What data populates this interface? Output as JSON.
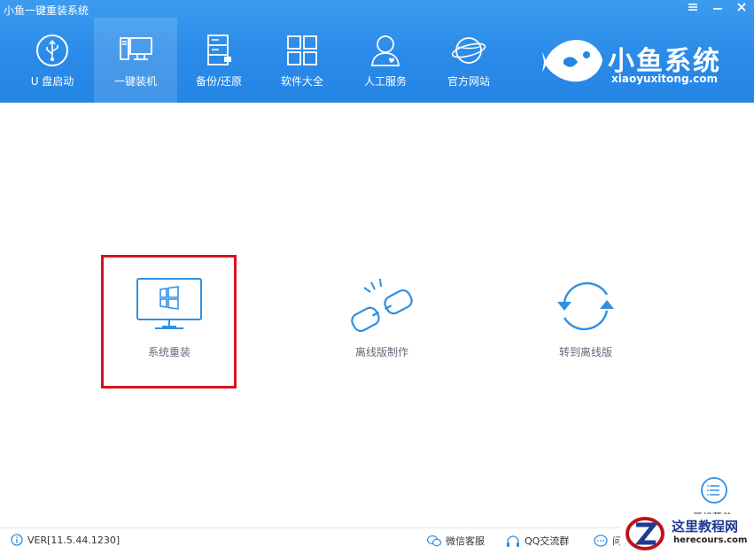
{
  "window": {
    "title": "小鱼一键重装系统",
    "controls": [
      "menu-icon",
      "minimize-icon",
      "close-icon"
    ]
  },
  "nav": {
    "items": [
      {
        "label": "U 盘启动",
        "icon": "usb-icon"
      },
      {
        "label": "一键装机",
        "icon": "desktop-icon",
        "active": true
      },
      {
        "label": "备份/还原",
        "icon": "backup-icon"
      },
      {
        "label": "软件大全",
        "icon": "apps-grid-icon"
      },
      {
        "label": "人工服务",
        "icon": "user-support-icon"
      },
      {
        "label": "官方网站",
        "icon": "globe-icon"
      }
    ]
  },
  "brand": {
    "name": "小鱼系统",
    "url": "xiaoyuxitong.com"
  },
  "features": [
    {
      "label": "系统重装",
      "icon": "windows-monitor-icon",
      "selected": true
    },
    {
      "label": "离线版制作",
      "icon": "broken-link-icon"
    },
    {
      "label": "转到离线版",
      "icon": "refresh-cycle-icon"
    }
  ],
  "side_menu": {
    "label": "开机菜单",
    "icon": "list-menu-icon"
  },
  "statusbar": {
    "version": "VER[11.5.44.1230]",
    "wechat": "微信客服",
    "qq": "QQ交流群",
    "faq": "问"
  },
  "watermark": {
    "cn": "这里教程网",
    "en": "herecours.com"
  },
  "colors": {
    "header_blue": "#2a8ae8",
    "icon_blue": "#2f8fe4",
    "selection_red": "#d7141a"
  }
}
